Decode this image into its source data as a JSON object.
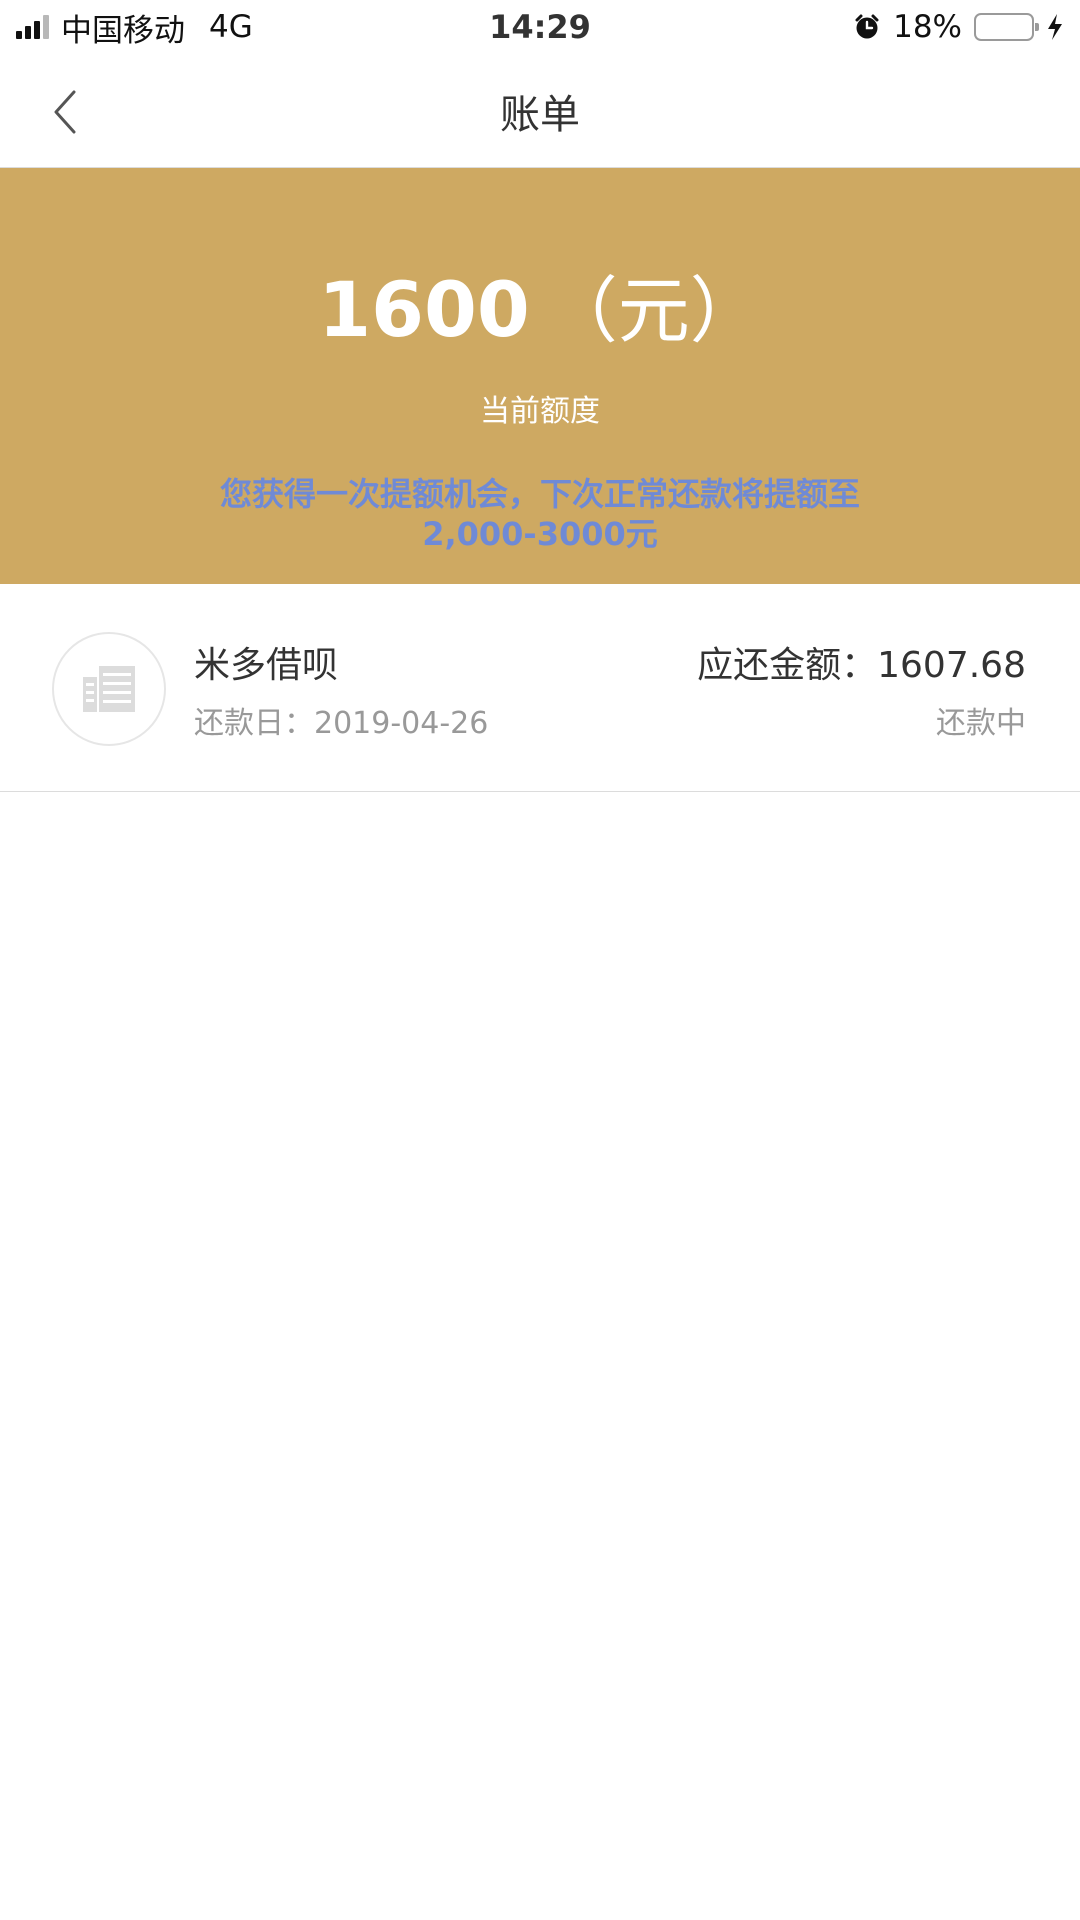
{
  "status_bar": {
    "carrier": "中国移动",
    "network": "4G",
    "time": "14:29",
    "battery_percent_text": "18%",
    "battery_level": 0.18,
    "icons": [
      "signal-icon",
      "alarm-icon",
      "battery-icon",
      "charging-bolt-icon"
    ]
  },
  "nav": {
    "title": "账单",
    "back_icon": "chevron-left-icon"
  },
  "limit": {
    "amount": "1600",
    "unit": "（元）",
    "label": "当前额度",
    "promo_line1": "您获得一次提额机会，下次正常还款将提额至",
    "promo_line2": "2,000-3000元"
  },
  "bills": [
    {
      "lender": "米多借呗",
      "due_date_label": "还款日：",
      "due_date": "2019-04-26",
      "amount_label": "应还金额：",
      "amount": "1607.68",
      "status": "还款中",
      "logo_icon": "building-icon"
    }
  ],
  "colors": {
    "banner": "#cea962",
    "promo_text": "#6f8ad6",
    "secondary_text": "#999999",
    "battery_fill": "#f5c400"
  }
}
